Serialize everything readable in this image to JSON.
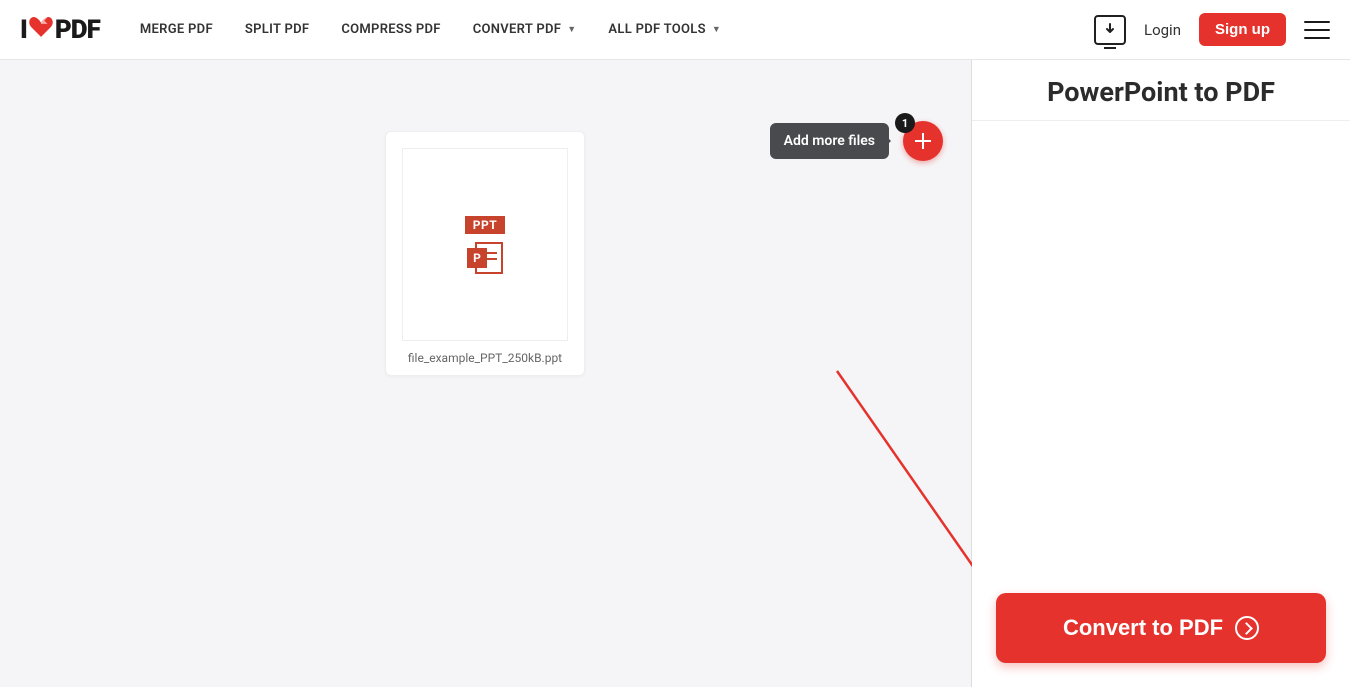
{
  "header": {
    "logo_pre": "I",
    "logo_post": "PDF",
    "nav": {
      "merge": "MERGE PDF",
      "split": "SPLIT PDF",
      "compress": "COMPRESS PDF",
      "convert": "CONVERT PDF",
      "all_tools": "ALL PDF TOOLS"
    },
    "login": "Login",
    "signup": "Sign up"
  },
  "workarea": {
    "add_more_tooltip": "Add more files",
    "file_count_badge": "1",
    "file": {
      "type_badge": "PPT",
      "icon_letter": "P",
      "name": "file_example_PPT_250kB.ppt"
    }
  },
  "sidebar": {
    "title": "PowerPoint to PDF",
    "convert_label": "Convert to PDF"
  },
  "colors": {
    "accent": "#e5322d"
  }
}
